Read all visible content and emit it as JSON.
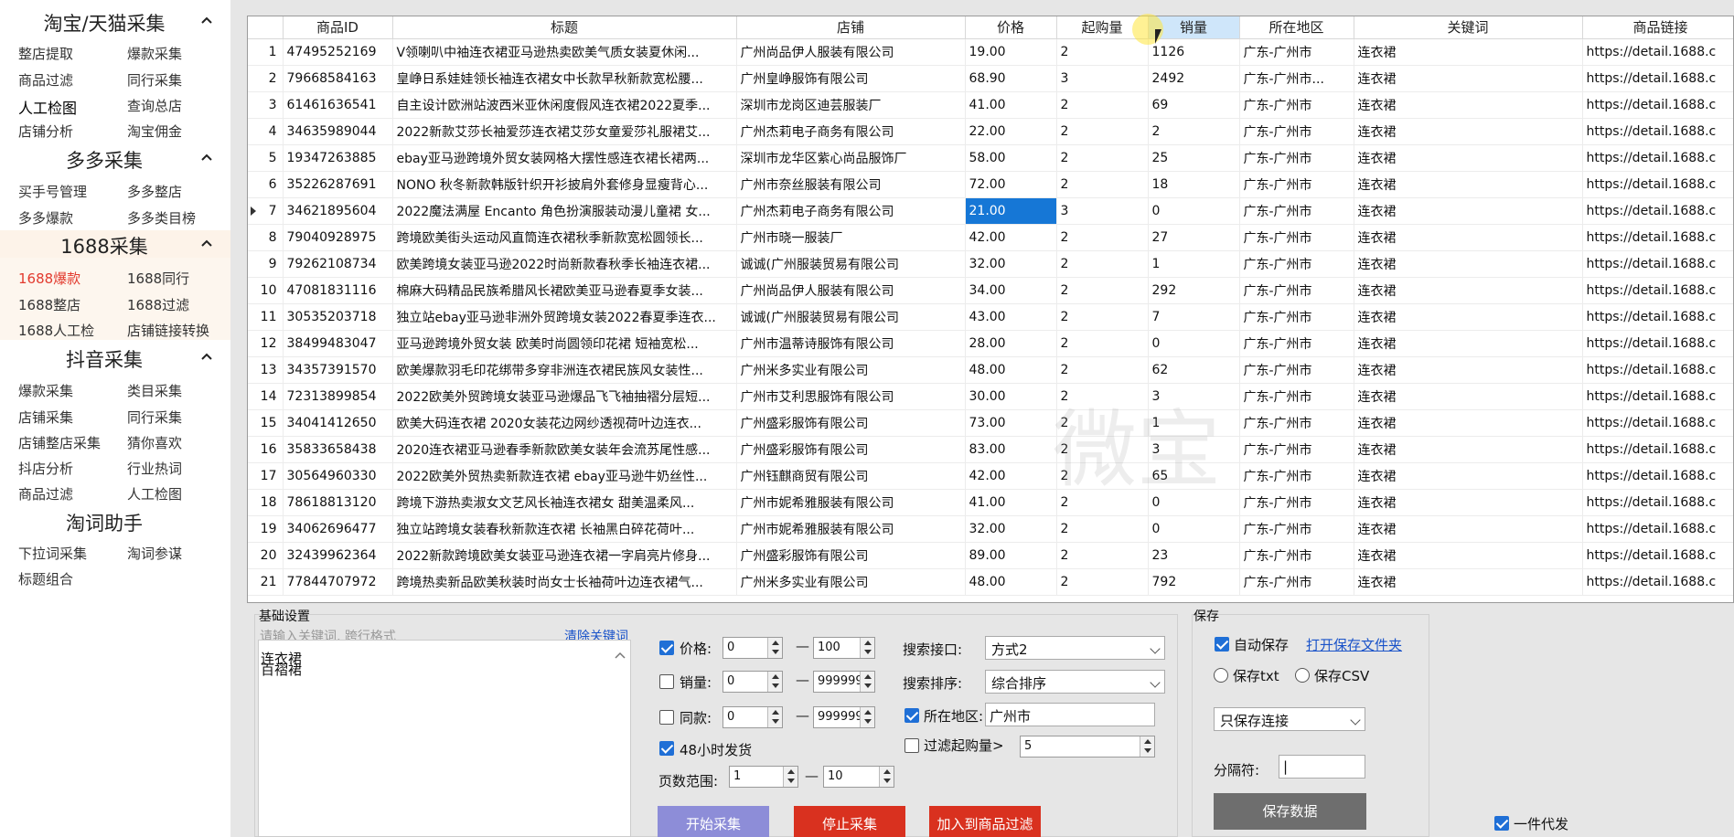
{
  "sidebar": {
    "sections": [
      {
        "title": "淘宝/天猫采集",
        "items": [
          "整店提取",
          "爆款采集",
          "商品过滤",
          "同行采集",
          "人工检图",
          "查询总店",
          "店铺分析",
          "淘宝佣金"
        ]
      },
      {
        "title": "多多采集",
        "items": [
          "买手号管理",
          "多多整店",
          "多多爆款",
          "多多类目榜"
        ]
      },
      {
        "title": "1688采集",
        "items": [
          "1688爆款",
          "1688同行",
          "1688整店",
          "1688过滤",
          "1688人工检",
          "店铺链接转换"
        ]
      },
      {
        "title": "抖音采集",
        "items": [
          "爆款采集",
          "类目采集",
          "店铺采集",
          "同行采集",
          "店铺整店采集",
          "猜你喜欢",
          "抖店分析",
          "行业热词",
          "商品过滤",
          "人工检图"
        ]
      },
      {
        "title": "淘词助手",
        "items": [
          "下拉词采集",
          "淘词参谋",
          "标题组合"
        ]
      }
    ]
  },
  "table": {
    "columns": [
      "商品ID",
      "标题",
      "店铺",
      "价格",
      "起购量",
      "销量",
      "所在地区",
      "关键词",
      "商品链接"
    ],
    "rows": [
      [
        "1",
        "47495252169",
        "V领喇叭中袖连衣裙亚马逊热卖欧美气质女装夏休闲...",
        "广州尚品伊人服装有限公司",
        "19.00",
        "2",
        "1126",
        "广东-广州市",
        "连衣裙",
        "https://detail.1688.c"
      ],
      [
        "2",
        "79668584163",
        "皇峥日系娃娃领长袖连衣裙女中长款早秋新款宽松腰...",
        "广州皇峥服饰有限公司",
        "68.90",
        "3",
        "2492",
        "广东-广州市...",
        "连衣裙",
        "https://detail.1688.c"
      ],
      [
        "3",
        "61461636541",
        "自主设计欧洲站波西米亚休闲度假风连衣裙2022夏季...",
        "深圳市龙岗区迪芸服装厂",
        "41.00",
        "2",
        "69",
        "广东-广州市",
        "连衣裙",
        "https://detail.1688.c"
      ],
      [
        "4",
        "34635989044",
        "2022新款艾莎长袖爱莎连衣裙艾莎女童爱莎礼服裙艾...",
        "广州杰莉电子商务有限公司",
        "22.00",
        "2",
        "2",
        "广东-广州市",
        "连衣裙",
        "https://detail.1688.c"
      ],
      [
        "5",
        "19347263885",
        "ebay亚马逊跨境外贸女装网格大摆性感连衣裙长裙两...",
        "深圳市龙华区紫心尚品服饰厂",
        "58.00",
        "2",
        "25",
        "广东-广州市",
        "连衣裙",
        "https://detail.1688.c"
      ],
      [
        "6",
        "35226287691",
        "NONO 秋冬新款韩版针织开衫披肩外套修身显瘦背心...",
        "广州市奈丝服装有限公司",
        "72.00",
        "2",
        "18",
        "广东-广州市",
        "连衣裙",
        "https://detail.1688.c"
      ],
      [
        "7",
        "34621895604",
        "2022魔法满屋 Encanto 角色扮演服装动漫儿童裙 女...",
        "广州杰莉电子商务有限公司",
        "21.00",
        "3",
        "0",
        "广东-广州市",
        "连衣裙",
        "https://detail.1688.c"
      ],
      [
        "8",
        "79040928975",
        "跨境欧美街头运动风直筒连衣裙秋季新款宽松圆领长...",
        "广州市晓一服装厂",
        "42.00",
        "2",
        "27",
        "广东-广州市",
        "连衣裙",
        "https://detail.1688.c"
      ],
      [
        "9",
        "79262108734",
        "欧美跨境女装亚马逊2022时尚新款春秋季长袖连衣裙...",
        "诚诚(广州服装贸易有限公司",
        "32.00",
        "2",
        "1",
        "广东-广州市",
        "连衣裙",
        "https://detail.1688.c"
      ],
      [
        "10",
        "47081831116",
        "棉麻大码精品民族希腊风长裙欧美亚马逊春夏季女装...",
        "广州尚品伊人服装有限公司",
        "34.00",
        "2",
        "292",
        "广东-广州市",
        "连衣裙",
        "https://detail.1688.c"
      ],
      [
        "11",
        "30535203718",
        "独立站ebay亚马逊非洲外贸跨境女装2022春夏季连衣...",
        "诚诚(广州服装贸易有限公司",
        "43.00",
        "2",
        "7",
        "广东-广州市",
        "连衣裙",
        "https://detail.1688.c"
      ],
      [
        "12",
        "38499483047",
        "亚马逊跨境外贸女装 欧美时尚圆领印花裙 短袖宽松...",
        "广州市温蒂诗服饰有限公司",
        "28.00",
        "2",
        "0",
        "广东-广州市",
        "连衣裙",
        "https://detail.1688.c"
      ],
      [
        "13",
        "34357391570",
        "欧美爆款羽毛印花绑带多穿非洲连衣裙民族风女装性...",
        "广州米多实业有限公司",
        "48.00",
        "2",
        "62",
        "广东-广州市",
        "连衣裙",
        "https://detail.1688.c"
      ],
      [
        "14",
        "72313899854",
        "2022欧美外贸跨境女装亚马逊爆品飞飞袖抽褶分层短...",
        "广州市艾利思服饰有限公司",
        "30.00",
        "2",
        "3",
        "广东-广州市",
        "连衣裙",
        "https://detail.1688.c"
      ],
      [
        "15",
        "34041412650",
        "欧美大码连衣裙 2020女装花边网纱透视荷叶边连衣...",
        "广州盛彩服饰有限公司",
        "73.00",
        "2",
        "1",
        "广东-广州市",
        "连衣裙",
        "https://detail.1688.c"
      ],
      [
        "16",
        "35833658438",
        "2020连衣裙亚马逊春季新款欧美女装年会流苏尾性感...",
        "广州盛彩服饰有限公司",
        "83.00",
        "2",
        "3",
        "广东-广州市",
        "连衣裙",
        "https://detail.1688.c"
      ],
      [
        "17",
        "30564960330",
        "2022欧美外贸热卖新款连衣裙 ebay亚马逊牛奶丝性...",
        "广州钰麒商贸有限公司",
        "42.00",
        "2",
        "65",
        "广东-广州市",
        "连衣裙",
        "https://detail.1688.c"
      ],
      [
        "18",
        "78618813120",
        "跨境下游热卖淑女文艺风长袖连衣裙女 甜美温柔风...",
        "广州市妮希雅服装有限公司",
        "41.00",
        "2",
        "0",
        "广东-广州市",
        "连衣裙",
        "https://detail.1688.c"
      ],
      [
        "19",
        "34062696477",
        "独立站跨境女装春秋新款连衣裙 长袖黑白碎花荷叶...",
        "广州市妮希雅服装有限公司",
        "32.00",
        "2",
        "0",
        "广东-广州市",
        "连衣裙",
        "https://detail.1688.c"
      ],
      [
        "20",
        "32439962364",
        "2022新款跨境欧美女装亚马逊连衣裙一字肩亮片修身...",
        "广州盛彩服饰有限公司",
        "89.00",
        "2",
        "23",
        "广东-广州市",
        "连衣裙",
        "https://detail.1688.c"
      ],
      [
        "21",
        "77844707972",
        "跨境热卖新品欧美秋装时尚女士长袖荷叶边连衣裙气...",
        "广州米多实业有限公司",
        "48.00",
        "2",
        "792",
        "广东-广州市",
        "连衣裙",
        "https://detail.1688.c"
      ]
    ],
    "watermark": "微宝"
  },
  "basic": {
    "title": "基础设置",
    "placeholder": "请输入关键词, 跨行格式",
    "clear_link": "清除关键词",
    "keywords": [
      "连衣裙",
      "百褶裙"
    ],
    "price_label": "价格:",
    "price_min": "0",
    "price_max": "100",
    "sales_label": "销量:",
    "sales_min": "0",
    "sales_max": "999999",
    "same_label": "同款:",
    "same_min": "0",
    "same_max": "999999",
    "ship48_label": "48小时发货",
    "page_label": "页数范围:",
    "page_min": "1",
    "page_max": "10",
    "dash": "—",
    "api_label": "搜索接口:",
    "api_value": "方式2",
    "sort_label": "搜索排序:",
    "sort_value": "综合排序",
    "region_label": "所在地区:",
    "region_value": "广州市",
    "minbuy_label": "过滤起购量>",
    "minbuy_value": "5",
    "start_btn": "开始采集",
    "stop_btn": "停止采集",
    "add_btn": "加入到商品过滤"
  },
  "save": {
    "title": "保存",
    "auto_label": "自动保存",
    "open_folder": "打开保存文件夹",
    "txt_label": "保存txt",
    "csv_label": "保存CSV",
    "mode_value": "只保存连接",
    "sep_label": "分隔符:",
    "sep_value": "|",
    "save_btn": "保存数据",
    "dropship_label": "一件代发"
  },
  "state": {
    "active_section": "1688采集",
    "active_item": "1688爆款",
    "selected_row": 7,
    "selected_col": "价格",
    "highlight_col": "销量"
  }
}
